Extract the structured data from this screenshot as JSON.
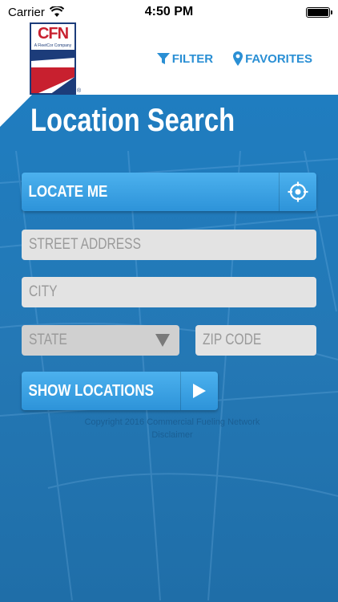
{
  "status_bar": {
    "carrier": "Carrier",
    "time": "4:50 PM"
  },
  "header": {
    "logo_text": "CFN",
    "logo_subtext": "A FleetCor Company",
    "filter_label": "FILTER",
    "favorites_label": "FAVORITES"
  },
  "page": {
    "title": "Location Search"
  },
  "form": {
    "locate_label": "LOCATE ME",
    "street_placeholder": "STREET ADDRESS",
    "city_placeholder": "CITY",
    "state_placeholder": "STATE",
    "zip_placeholder": "ZIP CODE",
    "show_label": "SHOW LOCATIONS"
  },
  "footer": {
    "copyright": "Copyright 2016 Commercial Fueling Network",
    "disclaimer": "Disclaimer"
  },
  "colors": {
    "accent": "#2a8fd4",
    "background_blue": "#2478b5",
    "button_blue": "#3da3e4",
    "brand_red": "#c8202f",
    "brand_navy": "#1c3c7a"
  },
  "icons": [
    "wifi-icon",
    "battery-icon",
    "filter-icon",
    "location-pin-icon",
    "crosshair-icon",
    "dropdown-arrow-icon",
    "play-arrow-icon"
  ]
}
